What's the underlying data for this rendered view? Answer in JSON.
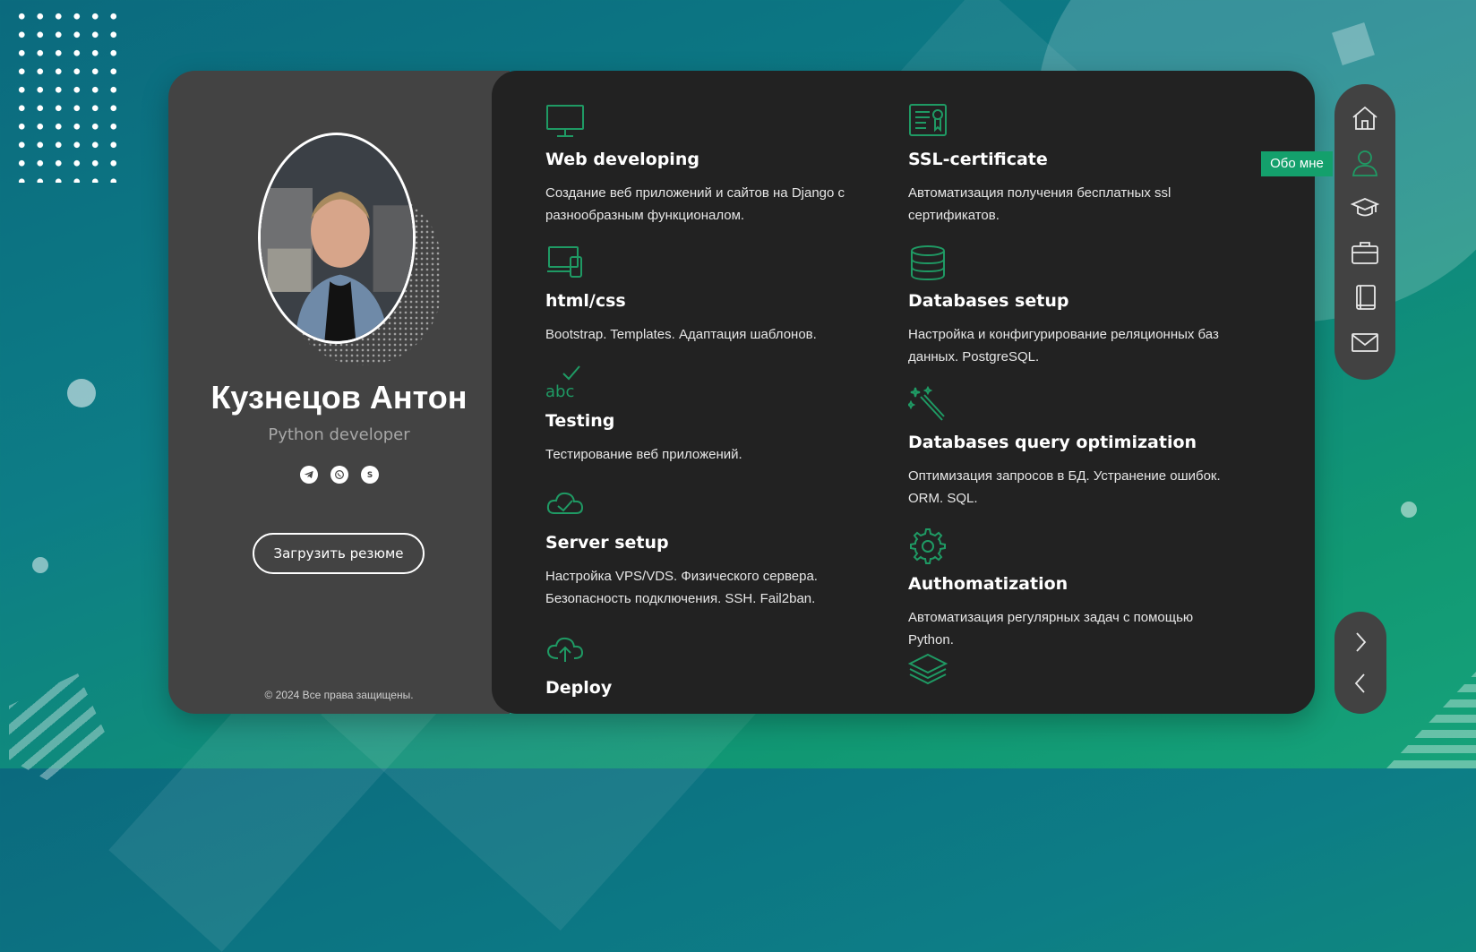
{
  "profile": {
    "name": "Кузнецов Антон",
    "role": "Python developer",
    "resume_button": "Загрузить резюме",
    "copyright": "© 2024 Все права защищены.",
    "socials": [
      "telegram-icon",
      "whatsapp-icon",
      "skype-icon"
    ]
  },
  "services": [
    {
      "icon": "monitor-icon",
      "title": "Web developing",
      "text": "Создание веб приложений и сайтов на Django с разнообразным функционалом."
    },
    {
      "icon": "devices-icon",
      "title": "html/css",
      "text": "Bootstrap. Templates. Адаптация шаблонов."
    },
    {
      "icon": "abc-check-icon",
      "title": "Testing",
      "text": "Тестирование веб приложений."
    },
    {
      "icon": "cloud-check-icon",
      "title": "Server setup",
      "text": "Настройка VPS/VDS. Физического сервера. Безопасность подключения. SSH. Fail2ban."
    },
    {
      "icon": "cloud-upload-icon",
      "title": "Deploy",
      "text": ""
    },
    {
      "icon": "certificate-icon",
      "title": "SSL-certificate",
      "text": "Автоматизация получения бесплатных ssl сертификатов."
    },
    {
      "icon": "database-icon",
      "title": "Databases setup",
      "text": "Настройка и конфигурирование реляционных баз данных. PostgreSQL."
    },
    {
      "icon": "magic-wand-icon",
      "title": "Databases query optimization",
      "text": "Оптимизация запросов в БД. Устранение ошибок. ORM. SQL."
    },
    {
      "icon": "gear-icon",
      "title": "Authomatization",
      "text": "Автоматизация регулярных задач с помощью Python."
    },
    {
      "icon": "layers-icon",
      "title": "",
      "text": ""
    }
  ],
  "nav": {
    "items": [
      "home-icon",
      "user-icon",
      "graduation-cap-icon",
      "briefcase-icon",
      "book-icon",
      "mail-icon"
    ],
    "active_tooltip": "Обо мне"
  },
  "colors": {
    "accent": "#14a06c",
    "icon_green": "#1f9a64",
    "panel_dark": "#222222",
    "panel_left": "#434343"
  }
}
